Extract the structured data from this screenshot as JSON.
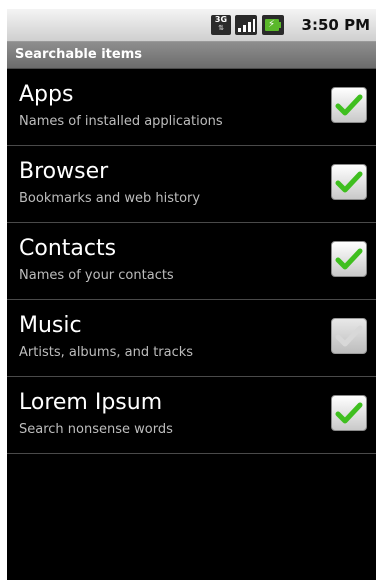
{
  "status_bar": {
    "network_label": "3G",
    "time": "3:50 PM",
    "icons": [
      "3g-network-icon",
      "signal-strength-icon",
      "battery-charging-icon"
    ]
  },
  "title": "Searchable items",
  "items": [
    {
      "title": "Apps",
      "summary": "Names of installed applications",
      "checked": true,
      "enabled": true
    },
    {
      "title": "Browser",
      "summary": "Bookmarks and web history",
      "checked": true,
      "enabled": true
    },
    {
      "title": "Contacts",
      "summary": "Names of your contacts",
      "checked": true,
      "enabled": true
    },
    {
      "title": "Music",
      "summary": "Artists, albums, and tracks",
      "checked": true,
      "enabled": false
    },
    {
      "title": "Lorem Ipsum",
      "summary": "Search nonsense words",
      "checked": true,
      "enabled": true
    }
  ],
  "colors": {
    "check_enabled": "#3fbf1f",
    "check_disabled": "#d8d8d8",
    "background": "#000000",
    "title_bar": "#7d7d7d"
  }
}
